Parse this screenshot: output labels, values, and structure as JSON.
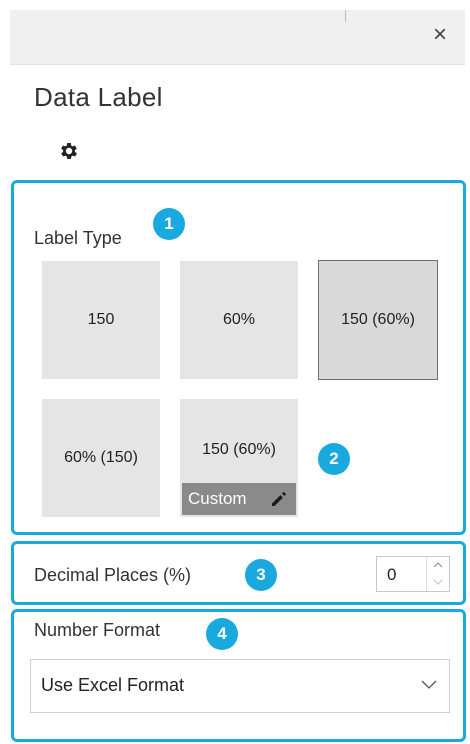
{
  "panel": {
    "title": "Data Label",
    "close_glyph": "×"
  },
  "label_type": {
    "heading": "Label Type",
    "badge": "1",
    "options": [
      {
        "label": "150",
        "selected": false
      },
      {
        "label": "60%",
        "selected": false
      },
      {
        "label": "150 (60%)",
        "selected": true
      },
      {
        "label": "60% (150)",
        "selected": false
      },
      {
        "label": "150 (60%)",
        "selected": false,
        "custom_label": "Custom"
      }
    ],
    "badge2": "2"
  },
  "decimal": {
    "label": "Decimal Places (%)",
    "badge": "3",
    "value": "0"
  },
  "number_format": {
    "label": "Number Format",
    "badge": "4",
    "selected": "Use Excel Format"
  },
  "colors": {
    "accent": "#1aa9de",
    "tile": "#e5e5e5",
    "custom_bar": "#8a8a8a"
  },
  "icons": [
    "close-icon",
    "gear-icon",
    "pencil-icon",
    "chevron-down-icon",
    "spin-up-icon",
    "spin-down-icon"
  ]
}
